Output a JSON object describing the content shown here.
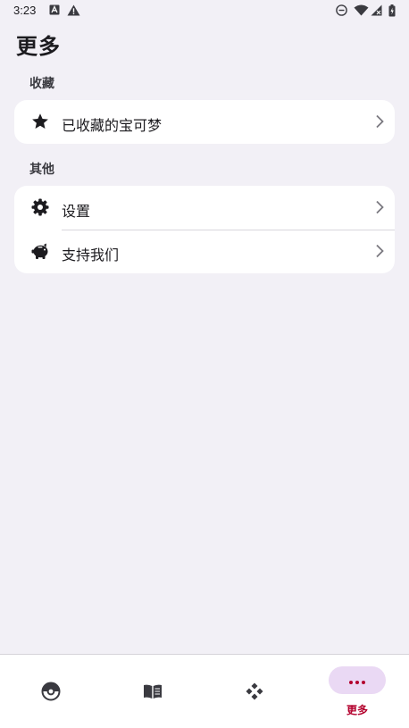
{
  "status_bar": {
    "time": "3:23",
    "icons": [
      "accessibility-icon",
      "warning-icon",
      "dnd-icon",
      "wifi-icon",
      "no-signal-icon",
      "battery-icon"
    ]
  },
  "page": {
    "title": "更多"
  },
  "sections": {
    "favorites": {
      "header": "收藏",
      "items": [
        {
          "label": "已收藏的宝可梦",
          "icon": "star-icon"
        }
      ]
    },
    "other": {
      "header": "其他",
      "items": [
        {
          "label": "设置",
          "icon": "gear-icon"
        },
        {
          "label": "支持我们",
          "icon": "piggy-bank-icon"
        }
      ]
    }
  },
  "bottom_nav": {
    "items": [
      {
        "icon": "pokeball-icon",
        "label": ""
      },
      {
        "icon": "book-icon",
        "label": ""
      },
      {
        "icon": "gamepad-icon",
        "label": ""
      },
      {
        "icon": "more-icon",
        "label": "更多",
        "active": true
      }
    ]
  },
  "colors": {
    "background": "#f2f0f6",
    "card": "#ffffff",
    "accent": "#b3002d",
    "active_pill": "#ead9f4"
  }
}
